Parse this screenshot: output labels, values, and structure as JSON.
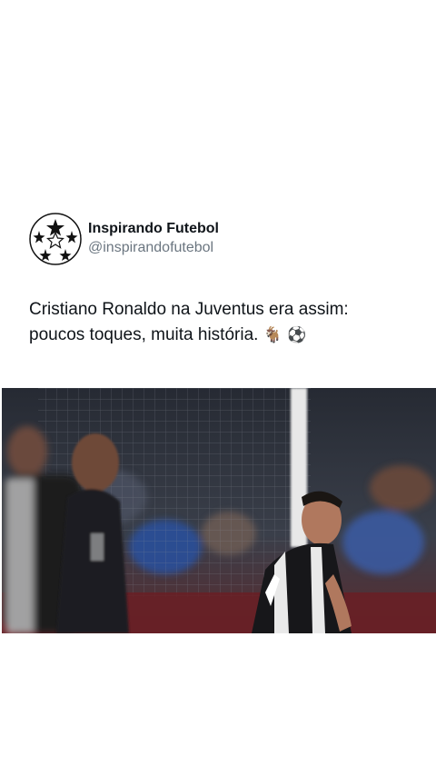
{
  "author": {
    "display_name": "Inspirando Futebol",
    "handle": "@inspirandofutebol",
    "avatar_icon": "starball-icon"
  },
  "post": {
    "line1": "Cristiano Ronaldo na Juventus era assim:",
    "line2": "poucos toques, muita história.",
    "emoji_goat": "🐐",
    "emoji_ball": "⚽"
  },
  "media": {
    "type": "photo",
    "description_icon": "football-photo-icon"
  },
  "colors": {
    "text_primary": "#0f1419",
    "text_secondary": "#6b7680",
    "background": "#ffffff"
  }
}
